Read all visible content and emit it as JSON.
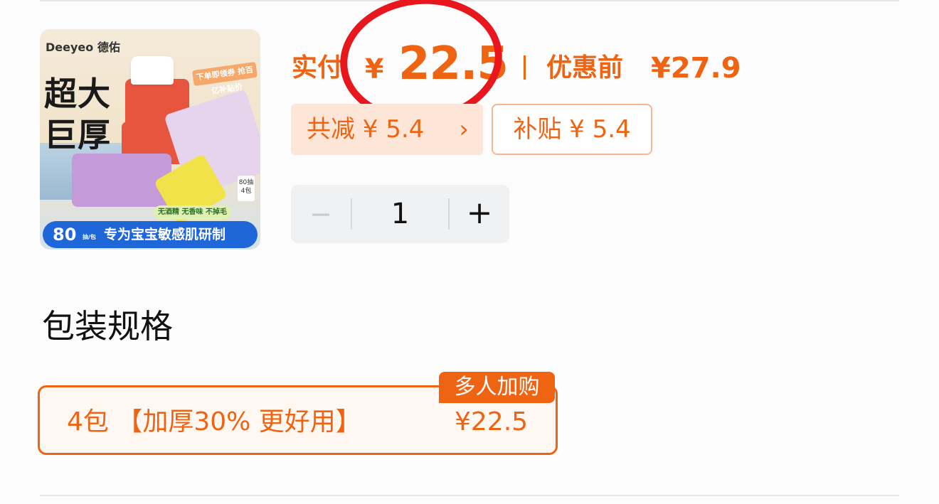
{
  "product": {
    "image": {
      "brand": "Deeyeo 德佑",
      "headline_line1": "超大",
      "headline_line2": "巨厚",
      "banner": "下单即领券 抢百亿补贴价",
      "count_top": "80抽",
      "count_bottom": "4包",
      "features": "无酒精 无香味 不掉毛",
      "bottom_number": "80",
      "bottom_unit": "抽/包",
      "bottom_text": "专为宝宝敏感肌研制"
    }
  },
  "price": {
    "label": "实付",
    "currency": "¥",
    "value": "22.5",
    "before_label": "优惠前",
    "before_value": "¥27.9"
  },
  "discounts": {
    "total": "共减 ¥ 5.4",
    "total_arrow": "›",
    "subsidy": "补贴 ¥ 5.4"
  },
  "quantity": {
    "minus": "−",
    "value": "1",
    "plus": "+"
  },
  "spec": {
    "title": "包装规格",
    "option": {
      "name": "4包 【加厚30% 更好用】",
      "price": "¥22.5",
      "badge": "多人加购"
    }
  },
  "colors": {
    "accent": "#ef6412",
    "annotation_circle": "#e8171e"
  }
}
